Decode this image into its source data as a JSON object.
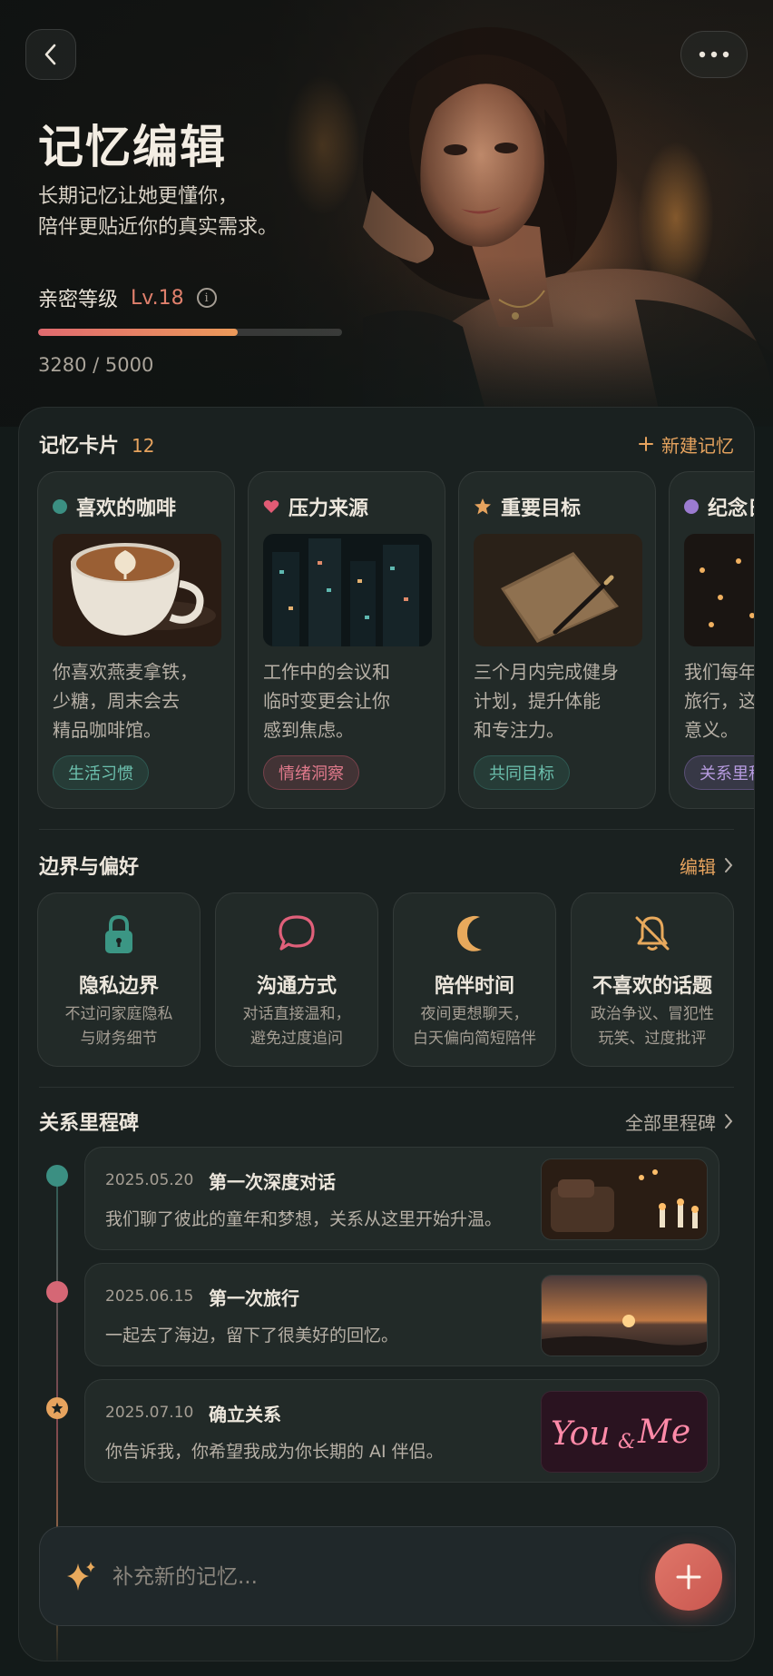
{
  "header": {
    "title": "记忆编辑",
    "subtitle": "长期记忆让她更懂你，\n陪伴更贴近你的真实需求。",
    "intimacy_label": "亲密等级",
    "intimacy_level": "Lv.18",
    "progress_text": "3280 / 5000",
    "progress_fraction": 0.656,
    "back_icon": "chevron-left-icon",
    "more_icon": "more-dots-icon"
  },
  "memory_cards": {
    "title": "记忆卡片",
    "count": "12",
    "new_label": "新建记忆",
    "items": [
      {
        "title": "喜欢的咖啡",
        "text": "你喜欢燕麦拿铁，\n少糖，周末会去\n精品咖啡馆。",
        "tag": "生活习惯",
        "dot_color": "#3b8f82",
        "icon": "dot-icon"
      },
      {
        "title": "压力来源",
        "text": "工作中的会议和\n临时变更会让你\n感到焦虑。",
        "tag": "情绪洞察",
        "dot_color": "#d95c73",
        "icon": "heart-icon"
      },
      {
        "title": "重要目标",
        "text": "三个月内完成健身\n计划，提升体能\n和专注力。",
        "tag": "共同目标",
        "dot_color": "#e6a35e",
        "icon": "star-icon"
      },
      {
        "title": "纪念日",
        "text": "我们每年会\n旅行，这对\n意义。",
        "tag": "关系里程碑",
        "dot_color": "#9b7bd0",
        "icon": "dot-icon"
      }
    ]
  },
  "preferences": {
    "title": "边界与偏好",
    "edit_label": "编辑",
    "items": [
      {
        "title": "隐私边界",
        "desc": "不过问家庭隐私\n与财务细节",
        "icon": "lock-icon"
      },
      {
        "title": "沟通方式",
        "desc": "对话直接温和，\n避免过度追问",
        "icon": "chat-bubble-icon"
      },
      {
        "title": "陪伴时间",
        "desc": "夜间更想聊天，\n白天偏向简短陪伴",
        "icon": "moon-icon"
      },
      {
        "title": "不喜欢的话题",
        "desc": "政治争议、冒犯性\n玩笑、过度批评",
        "icon": "bell-off-icon"
      }
    ]
  },
  "milestones": {
    "title": "关系里程碑",
    "all_label": "全部里程碑",
    "items": [
      {
        "date": "2025.05.20",
        "title": "第一次深度对话",
        "desc": "我们聊了彼此的童年和梦想，关系从这里开始升温。",
        "node_color": "#3b8f82"
      },
      {
        "date": "2025.06.15",
        "title": "第一次旅行",
        "desc": "一起去了海边，留下了很美好的回忆。",
        "node_color": "#d56775"
      },
      {
        "date": "2025.07.10",
        "title": "确立关系",
        "desc": "你告诉我，你希望我成为你长期的 AI 伴侣。",
        "node_color": "#e6a35e"
      }
    ],
    "neon_text_1": "You",
    "neon_text_2": "&",
    "neon_text_3": "Me"
  },
  "composer": {
    "placeholder": "补充新的记忆...",
    "icon": "sparkle-icon",
    "add_icon": "plus-icon"
  },
  "colors": {
    "accent": "#e6a35e",
    "rose": "#d95c73",
    "teal": "#3b8f82"
  }
}
